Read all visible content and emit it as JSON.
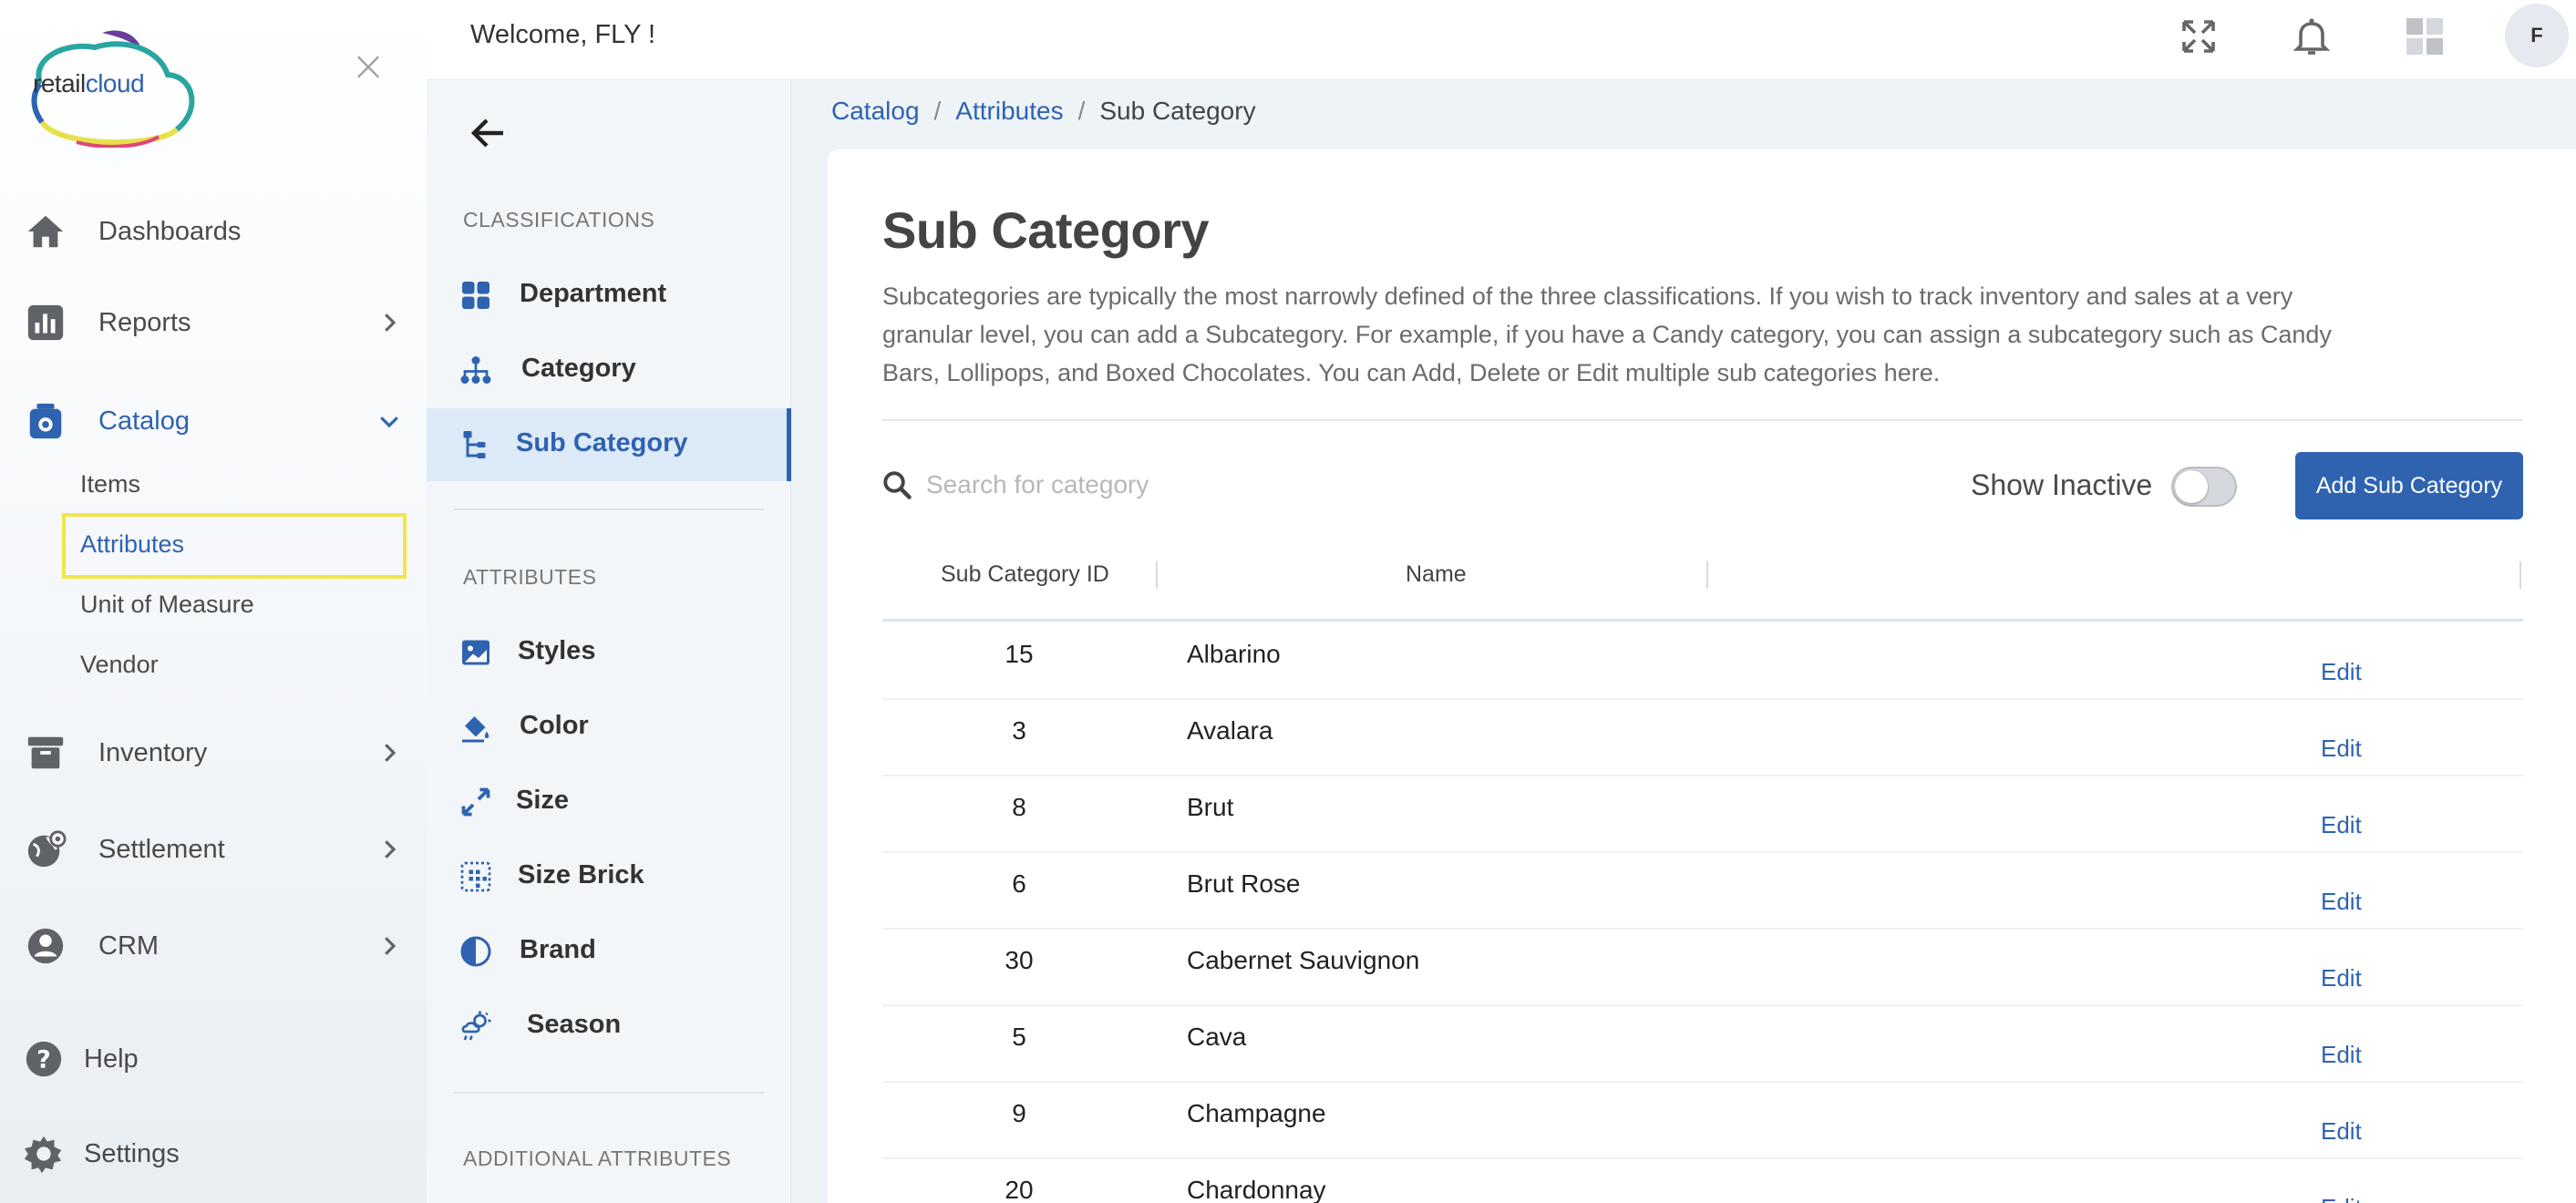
{
  "app": {
    "logo_text_1": "retail",
    "logo_text_2": "cloud",
    "welcome": "Welcome, FLY !",
    "avatar_initial": "F"
  },
  "colors": {
    "accent": "#2f63b0",
    "highlight_border": "#f3e64a",
    "active_bg": "#ddeaf8"
  },
  "sidebar": {
    "items": [
      {
        "label": "Dashboards",
        "icon": "home-icon"
      },
      {
        "label": "Reports",
        "icon": "bar-chart-icon"
      },
      {
        "label": "Catalog",
        "icon": "bag-icon"
      },
      {
        "label": "Inventory",
        "icon": "archive-icon"
      },
      {
        "label": "Settlement",
        "icon": "globe-icon"
      },
      {
        "label": "CRM",
        "icon": "user-gear-icon"
      },
      {
        "label": "Help",
        "icon": "help-icon"
      },
      {
        "label": "Settings",
        "icon": "gear-icon"
      }
    ],
    "catalog_sub": [
      "Items",
      "Attributes",
      "Unit of Measure",
      "Vendor"
    ]
  },
  "sub_sidebar": {
    "classifications_header": "CLASSIFICATIONS",
    "classifications": [
      "Department",
      "Category",
      "Sub Category"
    ],
    "attributes_header": "ATTRIBUTES",
    "attributes": [
      "Styles",
      "Color",
      "Size",
      "Size Brick",
      "Brand",
      "Season"
    ],
    "additional_header": "ADDITIONAL ATTRIBUTES"
  },
  "breadcrumb": {
    "catalog": "Catalog",
    "attributes": "Attributes",
    "current": "Sub Category",
    "sep": "/"
  },
  "page": {
    "title": "Sub Category",
    "description": "Subcategories are typically the most narrowly defined of the three classifications. If you wish to track inventory and sales at a very granular level, you can add a Subcategory. For example, if you have a Candy category, you can assign a subcategory such as Candy Bars, Lollipops, and Boxed Chocolates. You can Add, Delete or Edit multiple sub categories here.",
    "search_placeholder": "Search for category",
    "show_inactive": "Show Inactive",
    "add_button": "Add Sub Category"
  },
  "table": {
    "col_id": "Sub Category ID",
    "col_name": "Name",
    "edit_label": "Edit",
    "rows": [
      {
        "id": "15",
        "name": "Albarino"
      },
      {
        "id": "3",
        "name": "Avalara"
      },
      {
        "id": "8",
        "name": "Brut"
      },
      {
        "id": "6",
        "name": "Brut Rose"
      },
      {
        "id": "30",
        "name": "Cabernet Sauvignon"
      },
      {
        "id": "5",
        "name": "Cava"
      },
      {
        "id": "9",
        "name": "Champagne"
      },
      {
        "id": "20",
        "name": "Chardonnay"
      }
    ]
  }
}
